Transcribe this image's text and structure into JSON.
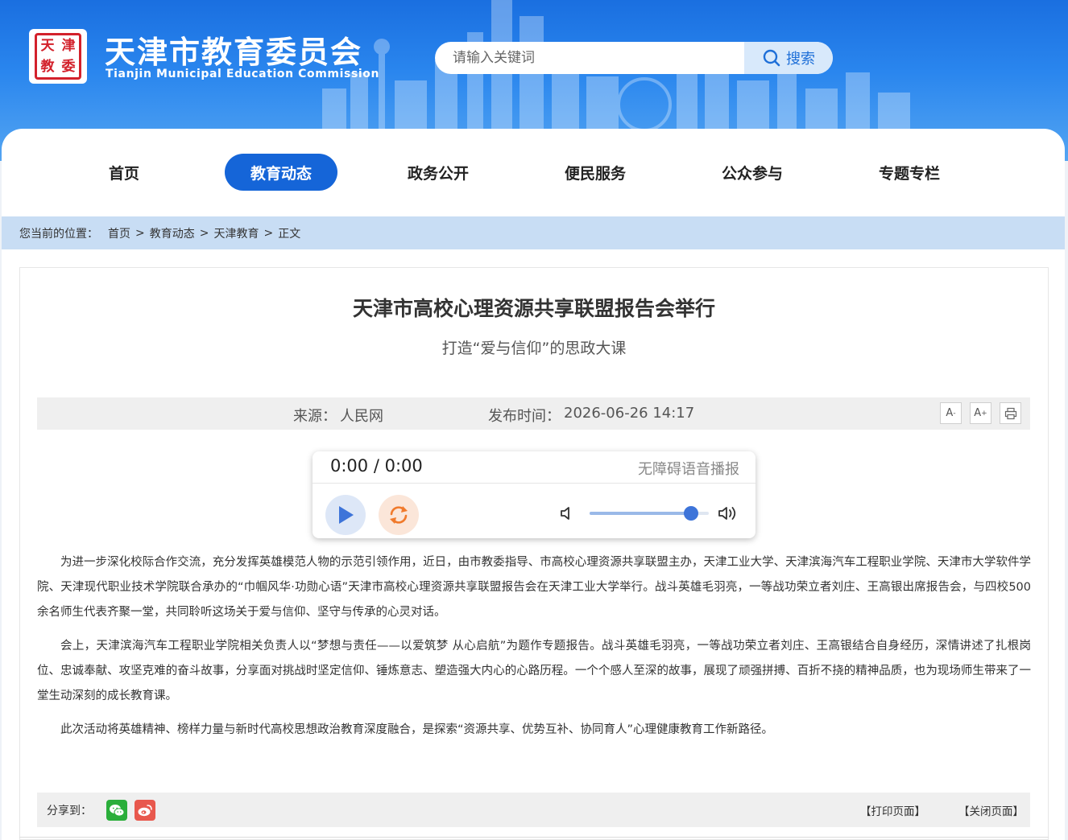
{
  "site": {
    "title": "天津市教育委员会",
    "subtitle": "Tianjin Municipal Education Commission"
  },
  "search": {
    "placeholder": "请输入关键词",
    "button_label": "搜索"
  },
  "nav": {
    "items": [
      {
        "label": "首页",
        "active": false
      },
      {
        "label": "教育动态",
        "active": true
      },
      {
        "label": "政务公开",
        "active": false
      },
      {
        "label": "便民服务",
        "active": false
      },
      {
        "label": "公众参与",
        "active": false
      },
      {
        "label": "专题专栏",
        "active": false
      }
    ]
  },
  "breadcrumb": {
    "prefix": "您当前的位置：",
    "items": [
      "首页",
      "教育动态",
      "天津教育",
      "正文"
    ],
    "separator": ">"
  },
  "article": {
    "title": "天津市高校心理资源共享联盟报告会举行",
    "subtitle": "打造“爱与信仰”的思政大课",
    "source_label": "来源：",
    "source": "人民网",
    "time_label": "发布时间：",
    "time": "2026-06-26 14:17",
    "paragraphs": [
      "为进一步深化校际合作交流，充分发挥英雄模范人物的示范引领作用，近日，由市教委指导、市高校心理资源共享联盟主办，天津工业大学、天津滨海汽车工程职业学院、天津市大学软件学院、天津现代职业技术学院联合承办的“巾帼风华·功勋心语”天津市高校心理资源共享联盟报告会在天津工业大学举行。战斗英雄毛羽亮，一等战功荣立者刘庄、王高银出席报告会，与四校500余名师生代表齐聚一堂，共同聆听这场关于爱与信仰、坚守与传承的心灵对话。",
      "会上，天津滨海汽车工程职业学院相关负责人以“梦想与责任——以爱筑梦 从心启航”为题作专题报告。战斗英雄毛羽亮，一等战功荣立者刘庄、王高银结合自身经历，深情讲述了扎根岗位、忠诚奉献、攻坚克难的奋斗故事，分享面对挑战时坚定信仰、锤炼意志、塑造强大内心的心路历程。一个个感人至深的故事，展现了顽强拼搏、百折不挠的精神品质，也为现场师生带来了一堂生动深刻的成长教育课。",
      "此次活动将英雄精神、榜样力量与新时代高校思想政治教育深度融合，是探索“资源共享、优势互补、协同育人”心理健康教育工作新路径。"
    ]
  },
  "tools": {
    "font_decrease": "A",
    "font_decrease_mark": "-",
    "font_increase": "A",
    "font_increase_mark": "+"
  },
  "player": {
    "time": "0:00 / 0:00",
    "label": "无障碍语音播报",
    "volume": 0.85
  },
  "share": {
    "label": "分享到：",
    "targets": [
      "wechat-icon",
      "weibo-icon"
    ],
    "print_label": "【打印页面】",
    "close_label": "【关闭页面】"
  },
  "colors": {
    "brand_blue": "#1565d8",
    "header_blue": "#2a86ee",
    "breadcrumb_bg": "#c8ddf4",
    "wechat_green": "#2aae3a",
    "weibo_red": "#e8584d"
  }
}
